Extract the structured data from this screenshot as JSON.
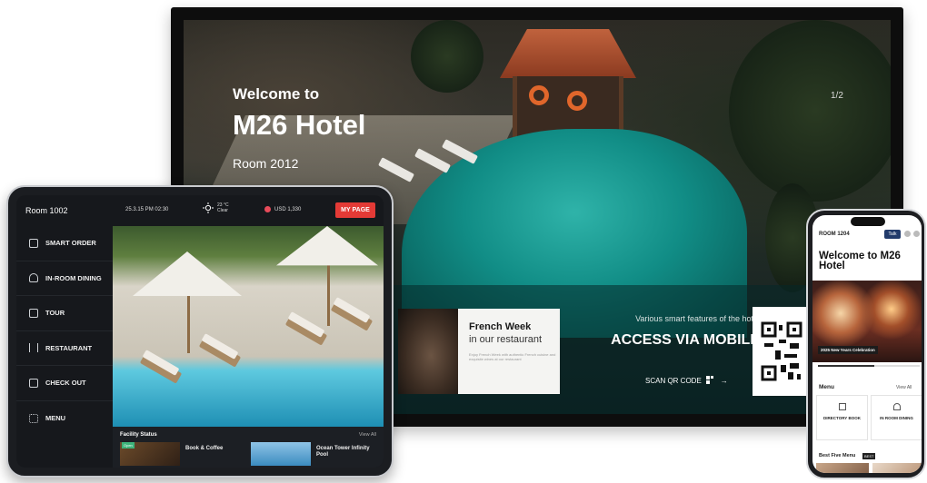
{
  "tv": {
    "welcome_line1": "Welcome to",
    "welcome_line2": "M26 Hotel",
    "room": "Room 2012",
    "pager": "1/2",
    "promo": {
      "title": "French Week",
      "subtitle": "in our restaurant",
      "description": "Enjoy French Week with authentic French cuisine and exquisite wines at our restaurant"
    },
    "features_line": "Various smart features of the hotel",
    "access_heading": "ACCESS VIA MOBILE",
    "scan_label": "SCAN QR CODE",
    "scan_icon": "qr-scan-icon"
  },
  "tablet": {
    "room": "Room 1002",
    "datetime": "25.3.15 PM 02:30",
    "weather": {
      "icon": "sun-icon",
      "temp": "23 °C",
      "desc": "Clear"
    },
    "currency": "USD 1,330",
    "mypage_label": "MY PAGE",
    "menu": [
      {
        "label": "SMART ORDER",
        "icon": "smart-order-icon"
      },
      {
        "label": "IN-ROOM DINING",
        "icon": "dining-icon"
      },
      {
        "label": "TOUR",
        "icon": "tour-icon"
      },
      {
        "label": "RESTAURANT",
        "icon": "restaurant-icon"
      },
      {
        "label": "CHECK OUT",
        "icon": "checkout-icon"
      },
      {
        "label": "MENU",
        "icon": "grid-menu-icon"
      }
    ],
    "facility": {
      "title": "Facility Status",
      "view_all": "View All",
      "items": [
        {
          "label": "Book & Coffee",
          "badge": "Open"
        },
        {
          "label": "Ocean Tower Infinity Pool"
        }
      ]
    }
  },
  "phone": {
    "room": "ROOM 1204",
    "talk_label": "Talk",
    "welcome": "Welcome to M26 Hotel",
    "event_caption": "2025 New Years Celebration",
    "slide_progress": 0.55,
    "menu_heading": "Menu",
    "view_all": "View All",
    "cards": [
      {
        "label": "DIRECTORY BOOK",
        "icon": "book-icon"
      },
      {
        "label": "IN ROOM DINING",
        "icon": "cloche-icon"
      }
    ],
    "best_menu": "Best Five Menu",
    "best_badge": "BEST"
  },
  "colors": {
    "accent_red": "#e43a36",
    "pool_teal": "#118d86",
    "dark_panel": "#16181c",
    "talk_navy": "#223b6b"
  }
}
